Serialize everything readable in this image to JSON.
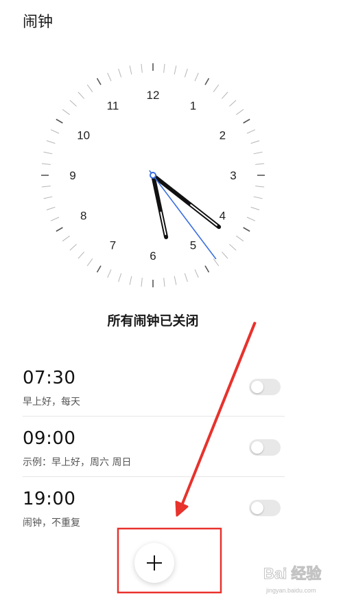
{
  "header": {
    "title": "闹钟"
  },
  "clock": {
    "numerals": [
      "12",
      "1",
      "2",
      "3",
      "4",
      "5",
      "6",
      "7",
      "8",
      "9",
      "10",
      "11"
    ],
    "time": {
      "hour": 4,
      "minute": 28,
      "second": 25
    },
    "second_hand_color": "#3b6fe0"
  },
  "status": {
    "text": "所有闹钟已关闭"
  },
  "alarms": [
    {
      "time": "07:30",
      "desc": "早上好，每天",
      "enabled": false
    },
    {
      "time": "09:00",
      "desc": "示例：早上好，周六 周日",
      "enabled": false
    },
    {
      "time": "19:00",
      "desc": "闹钟，不重复",
      "enabled": false
    }
  ],
  "fab": {
    "icon": "plus-icon"
  },
  "annotation": {
    "arrow_color": "#e8322c",
    "box_color": "#e8322c"
  },
  "watermark": {
    "text": "Bai 经验",
    "sub": "jingyan.baidu.com"
  }
}
